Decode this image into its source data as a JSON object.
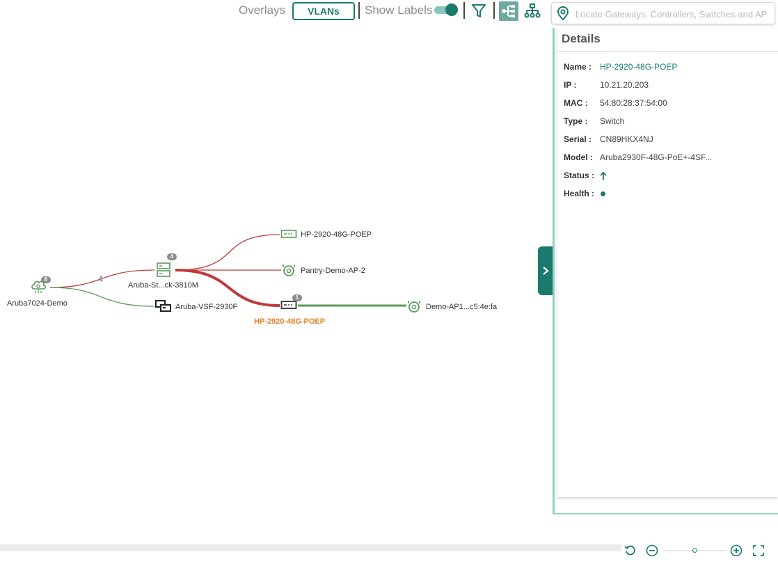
{
  "toolbar": {
    "overlays_label": "Overlays",
    "vlans_label": "VLANs",
    "show_labels": "Show Labels",
    "show_labels_on": true
  },
  "search": {
    "placeholder": "Locate Gateways, Controllers, Switches and AP"
  },
  "details": {
    "title": "Details",
    "rows": [
      {
        "label": "Name :",
        "value": "HP-2920-48G-POEP"
      },
      {
        "label": "IP :",
        "value": "10.21.20.203"
      },
      {
        "label": "MAC :",
        "value": "54:80:28:37:54:00"
      },
      {
        "label": "Type :",
        "value": "Switch"
      },
      {
        "label": "Serial :",
        "value": "CN89HKX4NJ"
      },
      {
        "label": "Model :",
        "value": "Aruba2930F-48G-PoE+-4SF..."
      },
      {
        "label": "Status :",
        "value": ""
      },
      {
        "label": "Health :",
        "value": ""
      }
    ]
  },
  "topology": {
    "nodes": {
      "gateway": {
        "label": "Aruba7024-Demo",
        "badge": "6"
      },
      "stack": {
        "label": "Aruba-St...ck-3810M",
        "badge": "4"
      },
      "vsf": {
        "label": "Aruba-VSF-2930F"
      },
      "switch_top": {
        "label": "HP-2920-48G-POEP"
      },
      "ap_pantry": {
        "label": "Pantry-Demo-AP-2"
      },
      "switch_selected": {
        "label": "HP-2920-48G-POEP",
        "badge": "1"
      },
      "ap_demo": {
        "label": "Demo-AP1...c5:4e:fa"
      }
    },
    "link_count": "4"
  },
  "colors": {
    "accent": "#1b7a6e",
    "link_red": "#c0393b",
    "link_green": "#5a9a5a",
    "selected_label": "#e67e22"
  },
  "icons": {
    "filter": "filter-icon",
    "layout_horizontal": "tree-horizontal-icon",
    "layout_vertical": "tree-vertical-icon",
    "location": "location-pin-icon",
    "reset": "reset-icon",
    "zoom_out": "zoom-out-icon",
    "zoom_in": "zoom-in-icon",
    "fullscreen": "fullscreen-icon",
    "collapse": "chevron-right-icon",
    "status_up": "arrow-up-icon"
  }
}
